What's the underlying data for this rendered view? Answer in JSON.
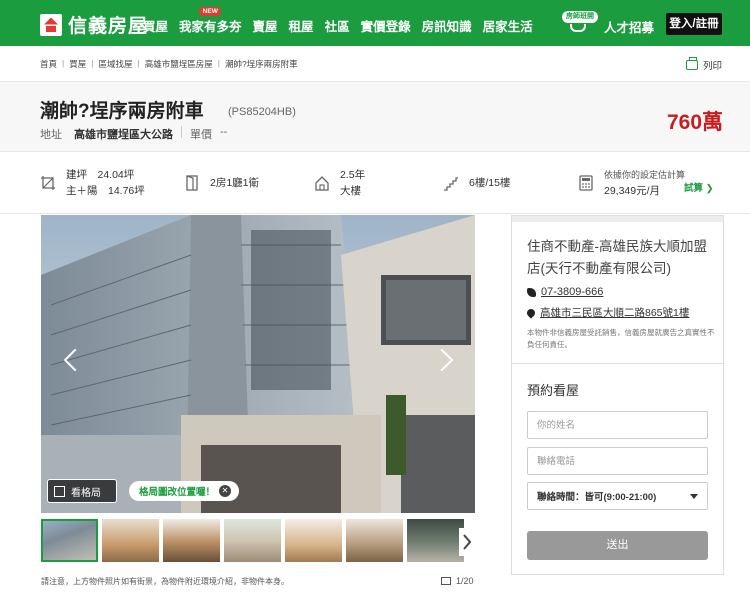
{
  "header": {
    "logo_text": "信義房屋",
    "nav": [
      {
        "label": "買屋",
        "badge": ""
      },
      {
        "label": "我家有多夯",
        "badge": "NEW"
      },
      {
        "label": "賣屋",
        "badge": ""
      },
      {
        "label": "租屋",
        "badge": ""
      },
      {
        "label": "社區",
        "badge": ""
      },
      {
        "label": "實價登錄",
        "badge": ""
      },
      {
        "label": "房訊知識",
        "badge": ""
      },
      {
        "label": "居家生活",
        "badge": ""
      }
    ],
    "recruit_badge": "房師班開",
    "recruit_label": "人才招募",
    "login_label": "登入/註冊",
    "brand_color": "#1a9c3f"
  },
  "breadcrumb": [
    "首頁",
    "買屋",
    "區域找屋",
    "高雄市鹽埕區房屋",
    "潮帥?埕序兩房附車"
  ],
  "print_label": "列印",
  "listing": {
    "title": "潮帥?埕序兩房附車",
    "code": "(PS85204HB)",
    "address_label": "地址",
    "address": "高雄市鹽埕區大公路",
    "unit_price_label": "單價",
    "unit_price": "--",
    "price": "760萬",
    "price_color": "#c41e20"
  },
  "info": {
    "area_line1": "建坪　24.04坪",
    "area_line2": "主＋陽　14.76坪",
    "layout": "2房1廳1衛",
    "age_line1": "2.5年",
    "age_line2": "大樓",
    "floor": "6樓/15樓",
    "calc_line1": "依據你的設定估計算",
    "calc_line2": "29,349元/月",
    "calc_link": "試算 ❯"
  },
  "gallery": {
    "layout_button": "看格局",
    "tip": "格局圖改位置囉！",
    "tip_close": "✕",
    "disclaimer": "請注意，上方物件照片如有街景，為物件附近環境介紹，非物件本身。",
    "counter": "1/20"
  },
  "agent": {
    "name": "住商不動產-高雄民族大順加盟店(天行不動產有限公司)",
    "phone": "07-3809-666",
    "address": "高雄市三民區大順二路865號1樓",
    "note": "本物件非信義房屋受託銷售，信義房屋就廣告之真實性不負任何責任。"
  },
  "booking": {
    "title": "預約看屋",
    "name_placeholder": "你的姓名",
    "phone_placeholder": "聯絡電話",
    "time_select": "聯絡時間：皆可(9:00-21:00)",
    "submit_label": "送出"
  }
}
